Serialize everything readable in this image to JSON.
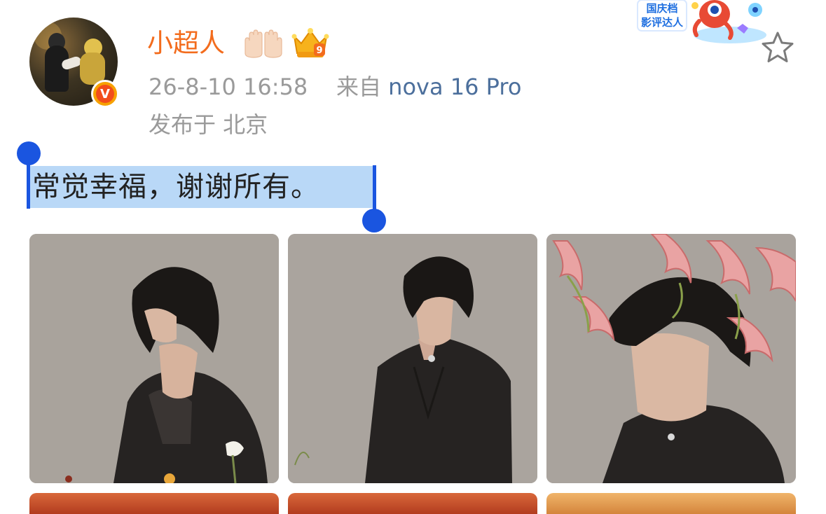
{
  "post": {
    "author": {
      "name": "小超人",
      "verified_badge": "V"
    },
    "meta": {
      "timestamp": "26-8-10 16:58",
      "source_prefix": "来自",
      "device": "nova 16 Pro",
      "location": "发布于 北京"
    },
    "event_badge": {
      "line1": "国庆档",
      "line2": "影评达人"
    },
    "crown_level": "9",
    "text": "常觉幸福，谢谢所有。",
    "selection_color": "#b9d8f7",
    "colors": {
      "username": "#f36c1d",
      "meta": "#9a9a9a",
      "device_link": "#4c6f9c",
      "selection_handle": "#1a55e0",
      "verified_badge": "#f7a100"
    },
    "icons": {
      "favorite": "star-outline-icon",
      "emoji": "raised-hands-emoji-icon",
      "crown": "crown-level-icon"
    },
    "photos": [
      {
        "name": "photo-1",
        "description_icon": "portrait-image"
      },
      {
        "name": "photo-2",
        "description_icon": "portrait-image"
      },
      {
        "name": "photo-3",
        "description_icon": "portrait-image"
      }
    ]
  }
}
